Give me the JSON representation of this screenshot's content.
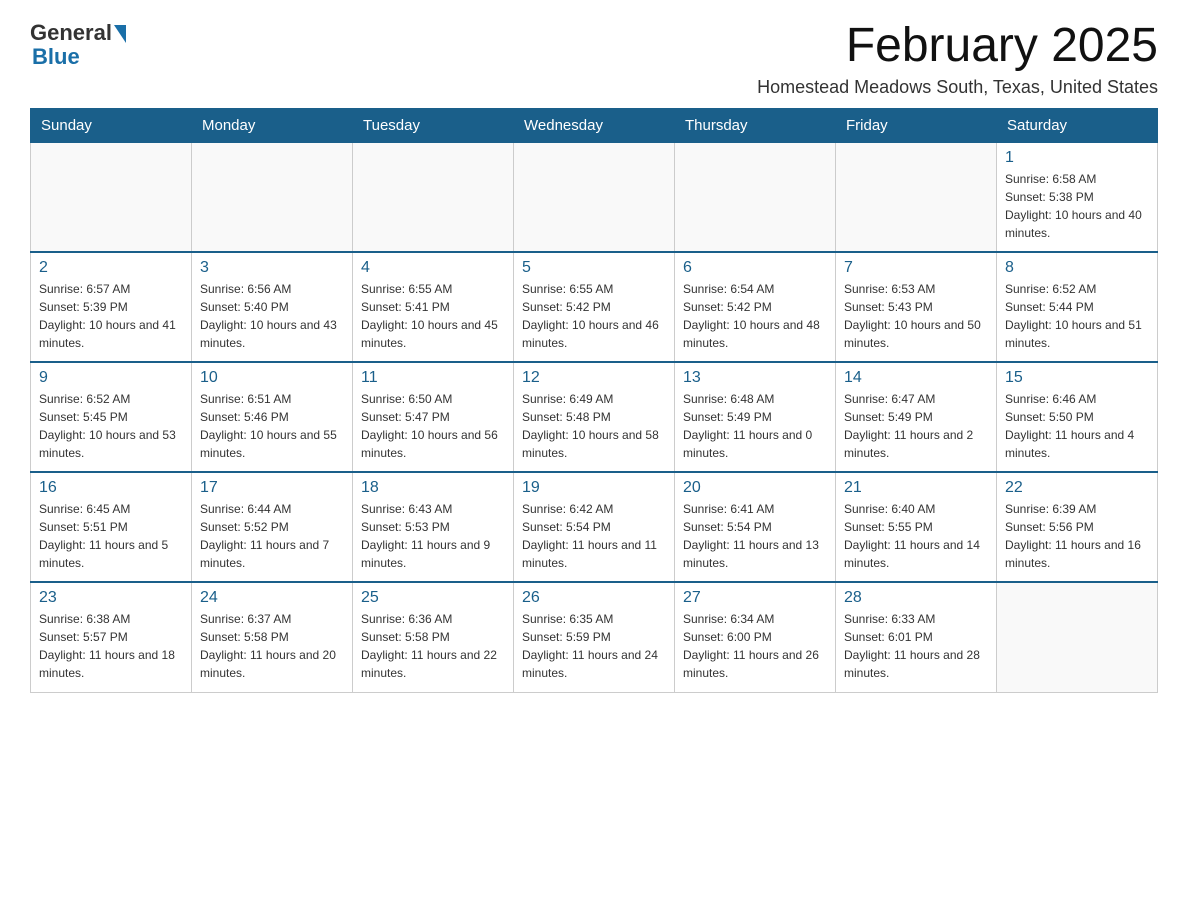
{
  "logo": {
    "general": "General",
    "blue": "Blue"
  },
  "title": "February 2025",
  "subtitle": "Homestead Meadows South, Texas, United States",
  "days_of_week": [
    "Sunday",
    "Monday",
    "Tuesday",
    "Wednesday",
    "Thursday",
    "Friday",
    "Saturday"
  ],
  "weeks": [
    [
      {
        "day": "",
        "info": ""
      },
      {
        "day": "",
        "info": ""
      },
      {
        "day": "",
        "info": ""
      },
      {
        "day": "",
        "info": ""
      },
      {
        "day": "",
        "info": ""
      },
      {
        "day": "",
        "info": ""
      },
      {
        "day": "1",
        "info": "Sunrise: 6:58 AM\nSunset: 5:38 PM\nDaylight: 10 hours and 40 minutes."
      }
    ],
    [
      {
        "day": "2",
        "info": "Sunrise: 6:57 AM\nSunset: 5:39 PM\nDaylight: 10 hours and 41 minutes."
      },
      {
        "day": "3",
        "info": "Sunrise: 6:56 AM\nSunset: 5:40 PM\nDaylight: 10 hours and 43 minutes."
      },
      {
        "day": "4",
        "info": "Sunrise: 6:55 AM\nSunset: 5:41 PM\nDaylight: 10 hours and 45 minutes."
      },
      {
        "day": "5",
        "info": "Sunrise: 6:55 AM\nSunset: 5:42 PM\nDaylight: 10 hours and 46 minutes."
      },
      {
        "day": "6",
        "info": "Sunrise: 6:54 AM\nSunset: 5:42 PM\nDaylight: 10 hours and 48 minutes."
      },
      {
        "day": "7",
        "info": "Sunrise: 6:53 AM\nSunset: 5:43 PM\nDaylight: 10 hours and 50 minutes."
      },
      {
        "day": "8",
        "info": "Sunrise: 6:52 AM\nSunset: 5:44 PM\nDaylight: 10 hours and 51 minutes."
      }
    ],
    [
      {
        "day": "9",
        "info": "Sunrise: 6:52 AM\nSunset: 5:45 PM\nDaylight: 10 hours and 53 minutes."
      },
      {
        "day": "10",
        "info": "Sunrise: 6:51 AM\nSunset: 5:46 PM\nDaylight: 10 hours and 55 minutes."
      },
      {
        "day": "11",
        "info": "Sunrise: 6:50 AM\nSunset: 5:47 PM\nDaylight: 10 hours and 56 minutes."
      },
      {
        "day": "12",
        "info": "Sunrise: 6:49 AM\nSunset: 5:48 PM\nDaylight: 10 hours and 58 minutes."
      },
      {
        "day": "13",
        "info": "Sunrise: 6:48 AM\nSunset: 5:49 PM\nDaylight: 11 hours and 0 minutes."
      },
      {
        "day": "14",
        "info": "Sunrise: 6:47 AM\nSunset: 5:49 PM\nDaylight: 11 hours and 2 minutes."
      },
      {
        "day": "15",
        "info": "Sunrise: 6:46 AM\nSunset: 5:50 PM\nDaylight: 11 hours and 4 minutes."
      }
    ],
    [
      {
        "day": "16",
        "info": "Sunrise: 6:45 AM\nSunset: 5:51 PM\nDaylight: 11 hours and 5 minutes."
      },
      {
        "day": "17",
        "info": "Sunrise: 6:44 AM\nSunset: 5:52 PM\nDaylight: 11 hours and 7 minutes."
      },
      {
        "day": "18",
        "info": "Sunrise: 6:43 AM\nSunset: 5:53 PM\nDaylight: 11 hours and 9 minutes."
      },
      {
        "day": "19",
        "info": "Sunrise: 6:42 AM\nSunset: 5:54 PM\nDaylight: 11 hours and 11 minutes."
      },
      {
        "day": "20",
        "info": "Sunrise: 6:41 AM\nSunset: 5:54 PM\nDaylight: 11 hours and 13 minutes."
      },
      {
        "day": "21",
        "info": "Sunrise: 6:40 AM\nSunset: 5:55 PM\nDaylight: 11 hours and 14 minutes."
      },
      {
        "day": "22",
        "info": "Sunrise: 6:39 AM\nSunset: 5:56 PM\nDaylight: 11 hours and 16 minutes."
      }
    ],
    [
      {
        "day": "23",
        "info": "Sunrise: 6:38 AM\nSunset: 5:57 PM\nDaylight: 11 hours and 18 minutes."
      },
      {
        "day": "24",
        "info": "Sunrise: 6:37 AM\nSunset: 5:58 PM\nDaylight: 11 hours and 20 minutes."
      },
      {
        "day": "25",
        "info": "Sunrise: 6:36 AM\nSunset: 5:58 PM\nDaylight: 11 hours and 22 minutes."
      },
      {
        "day": "26",
        "info": "Sunrise: 6:35 AM\nSunset: 5:59 PM\nDaylight: 11 hours and 24 minutes."
      },
      {
        "day": "27",
        "info": "Sunrise: 6:34 AM\nSunset: 6:00 PM\nDaylight: 11 hours and 26 minutes."
      },
      {
        "day": "28",
        "info": "Sunrise: 6:33 AM\nSunset: 6:01 PM\nDaylight: 11 hours and 28 minutes."
      },
      {
        "day": "",
        "info": ""
      }
    ]
  ]
}
